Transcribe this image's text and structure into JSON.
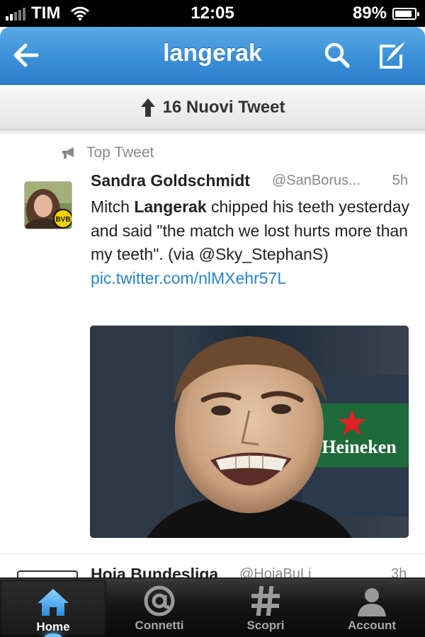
{
  "status_bar": {
    "carrier": "TIM",
    "time": "12:05",
    "battery_text": "89%",
    "battery_level": 0.89
  },
  "nav": {
    "title": "langerak",
    "back_icon": "back-arrow-icon",
    "search_icon": "search-icon",
    "compose_icon": "compose-icon"
  },
  "new_tweets": {
    "label": "16 Nuovi Tweet"
  },
  "top_tweet": {
    "label": "Top Tweet"
  },
  "tweet": {
    "author": "Sandra Goldschmidt",
    "handle": "@SanBorus...",
    "time": "5h",
    "text_before": "Mitch ",
    "text_highlight": "Langerak",
    "text_after": " chipped his teeth yesterday and said \"the match we lost hurts more than my teeth\". (via @Sky_StephanS) ",
    "link": "pic.twitter.com/nlMXehr57L",
    "photo_brand": "Heineken",
    "avatar_badge": "BVB"
  },
  "next_tweet": {
    "author": "Hoja Bundesliga",
    "handle": "@HojaBuLi",
    "time": "3h"
  },
  "tabs": [
    {
      "label": "Home",
      "icon": "home-icon",
      "active": true
    },
    {
      "label": "Connetti",
      "icon": "at-sign-icon",
      "active": false
    },
    {
      "label": "Scopri",
      "icon": "hashtag-icon",
      "active": false
    },
    {
      "label": "Account",
      "icon": "person-icon",
      "active": false
    }
  ],
  "colors": {
    "nav_blue": "#3b8fd8",
    "link_blue": "#2a84c6",
    "tab_active_glow": "#6fc3ff"
  }
}
